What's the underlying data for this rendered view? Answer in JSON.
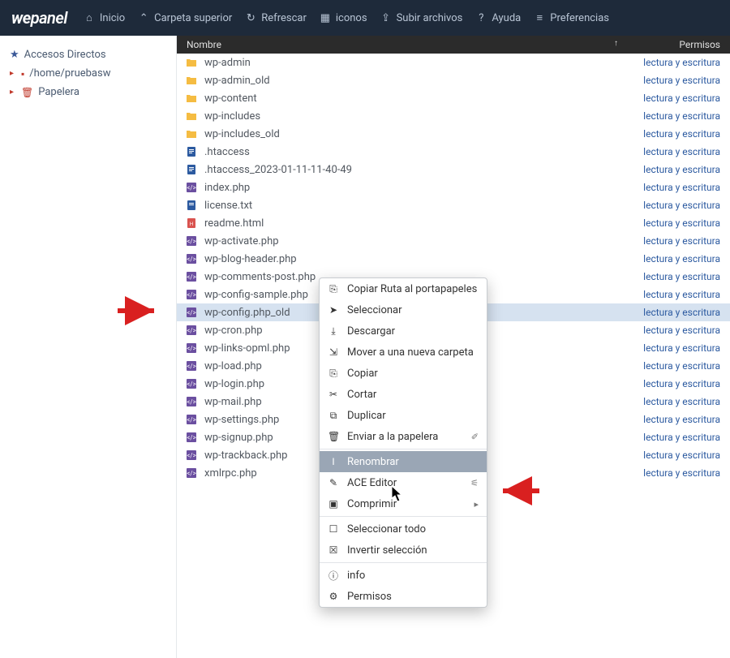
{
  "brand": {
    "we": "we",
    "panel": "panel"
  },
  "toolbar": [
    {
      "icon": "home",
      "label": "Inicio"
    },
    {
      "icon": "up",
      "label": "Carpeta superior"
    },
    {
      "icon": "refresh",
      "label": "Refrescar"
    },
    {
      "icon": "grid",
      "label": "iconos"
    },
    {
      "icon": "upload",
      "label": "Subir archivos"
    },
    {
      "icon": "help",
      "label": "Ayuda"
    },
    {
      "icon": "prefs",
      "label": "Preferencias"
    }
  ],
  "sidebar": {
    "fav_label": "Accesos Directos",
    "items": [
      {
        "icon": "hdd",
        "label": "/home/pruebasw"
      },
      {
        "icon": "trash",
        "label": "Papelera"
      }
    ]
  },
  "columns": {
    "name": "Nombre",
    "perms": "Permisos"
  },
  "files": [
    {
      "type": "folder",
      "name": "wp-admin",
      "perm": "lectura y escritura"
    },
    {
      "type": "folder",
      "name": "wp-admin_old",
      "perm": "lectura y escritura"
    },
    {
      "type": "folder",
      "name": "wp-content",
      "perm": "lectura y escritura"
    },
    {
      "type": "folder",
      "name": "wp-includes",
      "perm": "lectura y escritura"
    },
    {
      "type": "folder",
      "name": "wp-includes_old",
      "perm": "lectura y escritura"
    },
    {
      "type": "txt",
      "name": ".htaccess",
      "perm": "lectura y escritura"
    },
    {
      "type": "txt",
      "name": ".htaccess_2023-01-11-11-40-49",
      "perm": "lectura y escritura"
    },
    {
      "type": "code",
      "name": "index.php",
      "perm": "lectura y escritura"
    },
    {
      "type": "lic",
      "name": "license.txt",
      "perm": "lectura y escritura"
    },
    {
      "type": "html",
      "name": "readme.html",
      "perm": "lectura y escritura"
    },
    {
      "type": "code",
      "name": "wp-activate.php",
      "perm": "lectura y escritura"
    },
    {
      "type": "code",
      "name": "wp-blog-header.php",
      "perm": "lectura y escritura"
    },
    {
      "type": "code",
      "name": "wp-comments-post.php",
      "perm": "lectura y escritura"
    },
    {
      "type": "code",
      "name": "wp-config-sample.php",
      "perm": "lectura y escritura"
    },
    {
      "type": "code",
      "name": "wp-config.php_old",
      "perm": "lectura y escritura",
      "selected": true
    },
    {
      "type": "code",
      "name": "wp-cron.php",
      "perm": "lectura y escritura"
    },
    {
      "type": "code",
      "name": "wp-links-opml.php",
      "perm": "lectura y escritura"
    },
    {
      "type": "code",
      "name": "wp-load.php",
      "perm": "lectura y escritura"
    },
    {
      "type": "code",
      "name": "wp-login.php",
      "perm": "lectura y escritura"
    },
    {
      "type": "code",
      "name": "wp-mail.php",
      "perm": "lectura y escritura"
    },
    {
      "type": "code",
      "name": "wp-settings.php",
      "perm": "lectura y escritura"
    },
    {
      "type": "code",
      "name": "wp-signup.php",
      "perm": "lectura y escritura"
    },
    {
      "type": "code",
      "name": "wp-trackback.php",
      "perm": "lectura y escritura"
    },
    {
      "type": "code",
      "name": "xmlrpc.php",
      "perm": "lectura y escritura"
    }
  ],
  "context_menu": [
    {
      "icon": "clip",
      "label": "Copiar Ruta al portapapeles"
    },
    {
      "icon": "pointer",
      "label": "Seleccionar"
    },
    {
      "icon": "dl",
      "label": "Descargar"
    },
    {
      "icon": "move",
      "label": "Mover a una nueva carpeta"
    },
    {
      "icon": "copy",
      "label": "Copiar"
    },
    {
      "icon": "cut",
      "label": "Cortar"
    },
    {
      "icon": "dup",
      "label": "Duplicar"
    },
    {
      "icon": "trash",
      "label": "Enviar a la papelera",
      "right": "✐"
    },
    {
      "sep": true
    },
    {
      "icon": "rename",
      "label": "Renombrar",
      "hover": true
    },
    {
      "icon": "edit",
      "label": "ACE Editor",
      "right": "⚟"
    },
    {
      "icon": "zip",
      "label": "Comprimir",
      "right": "▸"
    },
    {
      "sep": true
    },
    {
      "icon": "selall",
      "label": "Seleccionar todo"
    },
    {
      "icon": "invsel",
      "label": "Invertir selección"
    },
    {
      "sep": true
    },
    {
      "icon": "info",
      "label": "info"
    },
    {
      "icon": "perms",
      "label": "Permisos"
    }
  ]
}
